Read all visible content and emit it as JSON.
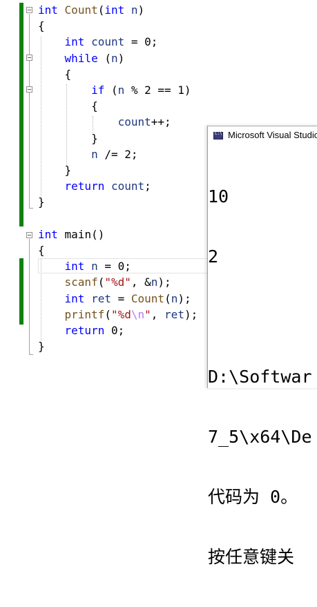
{
  "editor": {
    "lines": [
      {
        "indent": "",
        "parts": [
          {
            "t": "int",
            "c": "kw"
          },
          {
            "t": " "
          },
          {
            "t": "Count",
            "c": "fn"
          },
          {
            "t": "("
          },
          {
            "t": "int",
            "c": "kw"
          },
          {
            "t": " "
          },
          {
            "t": "n",
            "c": "var"
          },
          {
            "t": ")"
          }
        ]
      },
      {
        "indent": "",
        "parts": [
          {
            "t": "{"
          }
        ]
      },
      {
        "indent": "    ",
        "parts": [
          {
            "t": "int",
            "c": "kw"
          },
          {
            "t": " "
          },
          {
            "t": "count",
            "c": "var"
          },
          {
            "t": " = "
          },
          {
            "t": "0"
          },
          {
            "t": ";"
          }
        ]
      },
      {
        "indent": "    ",
        "parts": [
          {
            "t": "while",
            "c": "kw"
          },
          {
            "t": " ("
          },
          {
            "t": "n",
            "c": "var"
          },
          {
            "t": ")"
          }
        ]
      },
      {
        "indent": "    ",
        "parts": [
          {
            "t": "{"
          }
        ]
      },
      {
        "indent": "        ",
        "parts": [
          {
            "t": "if",
            "c": "kw"
          },
          {
            "t": " ("
          },
          {
            "t": "n",
            "c": "var"
          },
          {
            "t": " % 2 == 1)"
          }
        ]
      },
      {
        "indent": "        ",
        "parts": [
          {
            "t": "{"
          }
        ]
      },
      {
        "indent": "            ",
        "parts": [
          {
            "t": "count",
            "c": "var"
          },
          {
            "t": "++;"
          }
        ]
      },
      {
        "indent": "        ",
        "parts": [
          {
            "t": "}"
          }
        ]
      },
      {
        "indent": "        ",
        "parts": [
          {
            "t": "n",
            "c": "var"
          },
          {
            "t": " /= 2;"
          }
        ]
      },
      {
        "indent": "    ",
        "parts": [
          {
            "t": "}"
          }
        ]
      },
      {
        "indent": "    ",
        "parts": [
          {
            "t": "return",
            "c": "kw"
          },
          {
            "t": " "
          },
          {
            "t": "count",
            "c": "var"
          },
          {
            "t": ";"
          }
        ]
      },
      {
        "indent": "",
        "parts": [
          {
            "t": "}"
          }
        ]
      },
      {
        "indent": "",
        "parts": []
      },
      {
        "indent": "",
        "parts": [
          {
            "t": "int",
            "c": "kw"
          },
          {
            "t": " main()"
          }
        ]
      },
      {
        "indent": "",
        "parts": [
          {
            "t": "{"
          }
        ]
      },
      {
        "indent": "    ",
        "parts": [
          {
            "t": "int",
            "c": "kw"
          },
          {
            "t": " "
          },
          {
            "t": "n",
            "c": "var"
          },
          {
            "t": " = 0;"
          }
        ]
      },
      {
        "indent": "    ",
        "parts": [
          {
            "t": "scanf",
            "c": "fn"
          },
          {
            "t": "("
          },
          {
            "t": "\"%d\"",
            "c": "str"
          },
          {
            "t": ", &"
          },
          {
            "t": "n",
            "c": "var"
          },
          {
            "t": ");"
          }
        ]
      },
      {
        "indent": "    ",
        "parts": [
          {
            "t": "int",
            "c": "kw"
          },
          {
            "t": " "
          },
          {
            "t": "ret",
            "c": "var"
          },
          {
            "t": " = "
          },
          {
            "t": "Count",
            "c": "fn"
          },
          {
            "t": "("
          },
          {
            "t": "n",
            "c": "var"
          },
          {
            "t": ");"
          }
        ]
      },
      {
        "indent": "    ",
        "parts": [
          {
            "t": "printf",
            "c": "fn"
          },
          {
            "t": "("
          },
          {
            "t": "\"%d",
            "c": "str"
          },
          {
            "t": "\\n",
            "c": "esc"
          },
          {
            "t": "\"",
            "c": "str"
          },
          {
            "t": ", "
          },
          {
            "t": "ret",
            "c": "var"
          },
          {
            "t": ");"
          }
        ]
      },
      {
        "indent": "    ",
        "parts": [
          {
            "t": "return",
            "c": "kw"
          },
          {
            "t": " 0;"
          }
        ]
      },
      {
        "indent": "",
        "parts": [
          {
            "t": "}"
          }
        ]
      }
    ]
  },
  "console": {
    "title": "Microsoft Visual Studio",
    "output_lines": [
      "10",
      "2",
      "",
      "D:\\Softwar",
      "7_5\\x64\\De",
      "代码为 0。",
      "按任意键关"
    ]
  }
}
